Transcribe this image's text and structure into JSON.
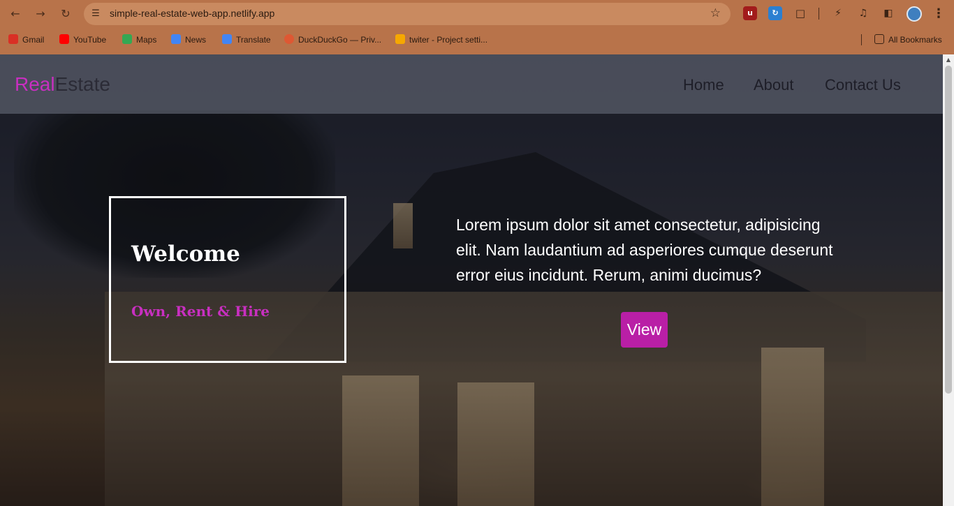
{
  "browser": {
    "url": "simple-real-estate-web-app.netlify.app",
    "nav": {
      "back_icon": "arrow-left-icon",
      "forward_icon": "arrow-right-icon",
      "reload_icon": "reload-icon"
    },
    "bookmarks": [
      {
        "label": "Gmail",
        "color": "#d93025"
      },
      {
        "label": "YouTube",
        "color": "#ff0000"
      },
      {
        "label": "Maps",
        "color": "#34a853"
      },
      {
        "label": "News",
        "color": "#4285f4"
      },
      {
        "label": "Translate",
        "color": "#4285f4"
      },
      {
        "label": "DuckDuckGo — Priv...",
        "color": "#de5833"
      },
      {
        "label": "twiter - Project setti...",
        "color": "#f6a800"
      }
    ],
    "all_bookmarks": "All Bookmarks"
  },
  "site": {
    "logo_part1": "Real",
    "logo_part2": "Estate",
    "menu": [
      "Home",
      "About",
      "Contact Us"
    ],
    "welcome_title": "Welcome",
    "welcome_subtitle": "Own, Rent & Hire",
    "description": "Lorem ipsum dolor sit amet consectetur, adipisicing elit. Nam laudantium ad asperiores cumque deserunt error eius incidunt. Rerum, animi ducimus?",
    "cta": "View"
  },
  "colors": {
    "accent": "#c82fc0",
    "chrome": "#b8734a",
    "button": "#b91fa6"
  }
}
